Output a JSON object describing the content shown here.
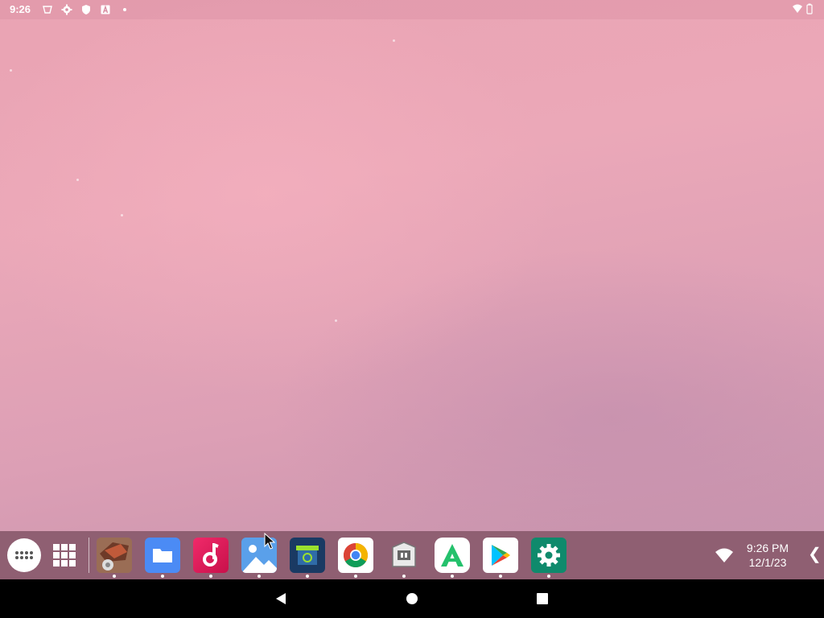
{
  "status_bar": {
    "time": "9:26",
    "left_icons": [
      "sim-alert-icon",
      "settings-gear-icon",
      "shield-icon",
      "keyboard-a-icon",
      "dot-icon"
    ],
    "right_icons": [
      "wifi-icon",
      "battery-icon"
    ]
  },
  "taskbar": {
    "apps": [
      {
        "name": "app-settings-artwork",
        "icon": "gear-artwork-icon"
      },
      {
        "name": "files",
        "icon": "folder-icon",
        "color": "#4b8bf5"
      },
      {
        "name": "music",
        "icon": "music-note-icon",
        "color": "#e0145a"
      },
      {
        "name": "gallery",
        "icon": "image-icon",
        "color": "#4a90e2"
      },
      {
        "name": "camera-app",
        "icon": "camera-icon",
        "color": "#1a3a63"
      },
      {
        "name": "chrome",
        "icon": "chrome-icon"
      },
      {
        "name": "store-app",
        "icon": "store-icon"
      },
      {
        "name": "apkpure",
        "icon": "apkpure-icon",
        "color": "#24c16c"
      },
      {
        "name": "play-store",
        "icon": "play-store-icon"
      },
      {
        "name": "settings",
        "icon": "gear-icon",
        "color": "#0f8a6c"
      }
    ],
    "clock_time": "9:26 PM",
    "clock_date": "12/1/23",
    "collapse_label": "❮"
  },
  "nav": {
    "buttons": [
      "back",
      "home",
      "recents"
    ]
  }
}
